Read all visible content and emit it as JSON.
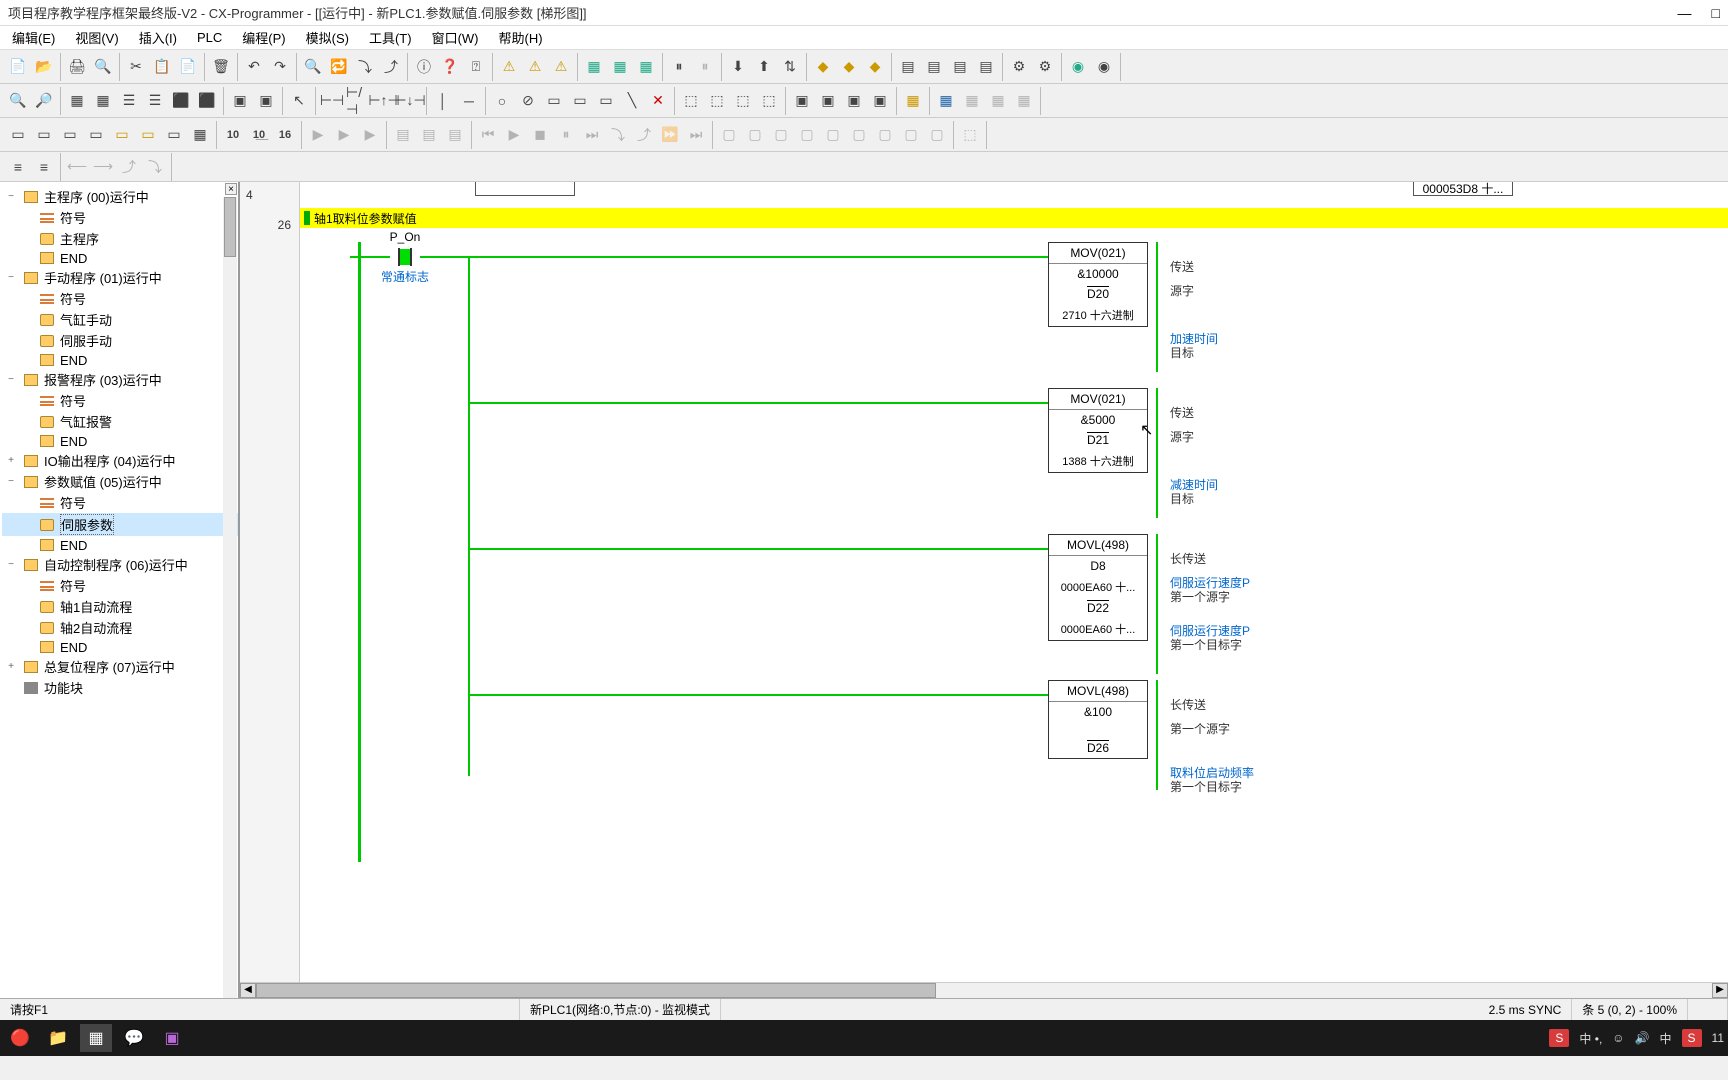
{
  "titlebar": {
    "text": "项目程序教学程序框架最终版-V2 - CX-Programmer - [[运行中] - 新PLC1.参数赋值.伺服参数 [梯形图]]"
  },
  "menu": {
    "file": "",
    "edit": "编辑(E)",
    "view": "视图(V)",
    "insert": "插入(I)",
    "plc": "PLC",
    "program": "编程(P)",
    "simulate": "模拟(S)",
    "tools": "工具(T)",
    "window": "窗口(W)",
    "help": "帮助(H)"
  },
  "tree": {
    "items": [
      {
        "label": "主程序 (00)运行中",
        "icon": "prog",
        "toggle": "−",
        "indent": 0
      },
      {
        "label": "符号",
        "icon": "sym",
        "indent": 1
      },
      {
        "label": "主程序",
        "icon": "sec",
        "indent": 1
      },
      {
        "label": "END",
        "icon": "end",
        "indent": 1
      },
      {
        "label": "手动程序 (01)运行中",
        "icon": "prog",
        "toggle": "−",
        "indent": 0
      },
      {
        "label": "符号",
        "icon": "sym",
        "indent": 1
      },
      {
        "label": "气缸手动",
        "icon": "sec",
        "indent": 1
      },
      {
        "label": "伺服手动",
        "icon": "sec",
        "indent": 1
      },
      {
        "label": "END",
        "icon": "end",
        "indent": 1
      },
      {
        "label": "报警程序 (03)运行中",
        "icon": "prog",
        "toggle": "−",
        "indent": 0
      },
      {
        "label": "符号",
        "icon": "sym",
        "indent": 1
      },
      {
        "label": "气缸报警",
        "icon": "sec",
        "indent": 1
      },
      {
        "label": "END",
        "icon": "end",
        "indent": 1
      },
      {
        "label": "IO输出程序 (04)运行中",
        "icon": "prog",
        "toggle": "+",
        "indent": 0
      },
      {
        "label": "参数赋值 (05)运行中",
        "icon": "prog",
        "toggle": "−",
        "indent": 0
      },
      {
        "label": "符号",
        "icon": "sym",
        "indent": 1
      },
      {
        "label": "伺服参数",
        "icon": "sec",
        "indent": 1,
        "selected": true
      },
      {
        "label": "END",
        "icon": "end",
        "indent": 1
      },
      {
        "label": "自动控制程序 (06)运行中",
        "icon": "prog",
        "toggle": "−",
        "indent": 0
      },
      {
        "label": "符号",
        "icon": "sym",
        "indent": 1
      },
      {
        "label": "轴1自动流程",
        "icon": "sec",
        "indent": 1
      },
      {
        "label": "轴2自动流程",
        "icon": "sec",
        "indent": 1
      },
      {
        "label": "END",
        "icon": "end",
        "indent": 1
      },
      {
        "label": "总复位程序 (07)运行中",
        "icon": "prog",
        "toggle": "+",
        "indent": 0
      },
      {
        "label": "功能块",
        "icon": "fb",
        "indent": 0
      }
    ]
  },
  "ladder": {
    "gutter_main": "4",
    "rung_num": "26",
    "partial_top": "000053D8 十...",
    "rung_title": "轴1取料位参数赋值",
    "contact": {
      "label": "P_On",
      "below": "常通标志"
    },
    "blocks": [
      {
        "title": "MOV(021)",
        "r1": "&10000",
        "r2": "D20",
        "r3": "2710 十六进制",
        "a1": "传送",
        "a2": "源字",
        "a3_link": "加速时间",
        "a3": "目标"
      },
      {
        "title": "MOV(021)",
        "r1": "&5000",
        "r2": "D21",
        "r3": "1388 十六进制",
        "a1": "传送",
        "a2": "源字",
        "a3_link": "减速时间",
        "a3": "目标"
      },
      {
        "title": "MOVL(498)",
        "r1": "D8",
        "r1b": "0000EA60 十...",
        "r2": "D22",
        "r2b": "0000EA60 十...",
        "a1": "长传送",
        "a2_link": "伺服运行速度P",
        "a2": "第一个源字",
        "a3_link": "伺服运行速度P",
        "a3": "第一个目标字"
      },
      {
        "title": "MOVL(498)",
        "r1": "&100",
        "r2": "D26",
        "a1": "长传送",
        "a2": "第一个源字",
        "a3_link": "取料位启动频率",
        "a3": "第一个目标字"
      }
    ]
  },
  "status": {
    "help": "请按F1",
    "plc": "新PLC1(网络:0,节点:0) - 监视模式",
    "sync": "2.5 ms SYNC",
    "pos": "条 5 (0, 2) - 100%"
  },
  "taskbar": {
    "time": "11"
  }
}
